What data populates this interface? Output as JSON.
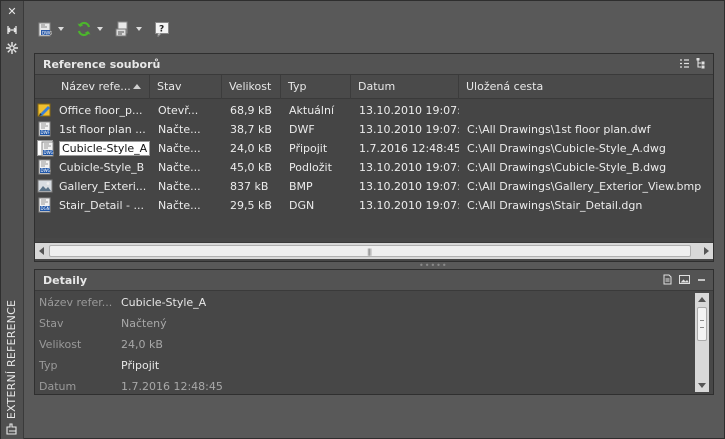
{
  "palette": {
    "panel_title": "EXTERNÍ REFERENCE"
  },
  "toolbar": {
    "buttons": [
      {
        "icon": "attach-dwg-icon",
        "has_dropdown": true
      },
      {
        "icon": "refresh-icon",
        "has_dropdown": true
      },
      {
        "icon": "change-path-icon",
        "has_dropdown": true
      },
      {
        "icon": "help-icon",
        "has_dropdown": false
      }
    ]
  },
  "file_references": {
    "title": "Reference souborů",
    "columns": [
      "Název refe...",
      "Stav",
      "Velikost",
      "Typ",
      "Datum",
      "Uložená cesta"
    ],
    "rows": [
      {
        "icon": "drawing-current-icon",
        "name": "Office floor_p...",
        "status": "Otevř...",
        "size": "68,9 kB",
        "type": "Aktuální",
        "date": "13.10.2010 19:07:...",
        "path": ""
      },
      {
        "icon": "dwf-file-icon",
        "name": "1st floor plan ...",
        "status": "Načte...",
        "size": "38,7 kB",
        "type": "DWF",
        "date": "13.10.2010 19:07:...",
        "path": "C:\\All Drawings\\1st floor plan.dwf"
      },
      {
        "icon": "dwg-file-icon",
        "name": "Cubicle-Style_A",
        "status": "Načte...",
        "size": "24,0 kB",
        "type": "Připojit",
        "date": "1.7.2016 12:48:45",
        "path": "C:\\All Drawings\\Cubicle-Style_A.dwg"
      },
      {
        "icon": "dwg-file-icon",
        "name": "Cubicle-Style_B",
        "status": "Načte...",
        "size": "45,0 kB",
        "type": "Podložit",
        "date": "13.10.2010 19:07:...",
        "path": "C:\\All Drawings\\Cubicle-Style_B.dwg"
      },
      {
        "icon": "image-file-icon",
        "name": "Gallery_Exteri...",
        "status": "Načte...",
        "size": "837 kB",
        "type": "BMP",
        "date": "13.10.2010 19:07:...",
        "path": "C:\\All Drawings\\Gallery_Exterior_View.bmp"
      },
      {
        "icon": "dgn-file-icon",
        "name": "Stair_Detail - ...",
        "status": "Načte...",
        "size": "29,5 kB",
        "type": "DGN",
        "date": "13.10.2010 19:07:...",
        "path": "C:\\All Drawings\\Stair_Detail.dgn"
      }
    ]
  },
  "details": {
    "title": "Detaily",
    "fields": [
      {
        "label": "Název refer...",
        "value": "Cubicle-Style_A",
        "muted": false
      },
      {
        "label": "Stav",
        "value": "Načtený",
        "muted": true
      },
      {
        "label": "Velikost",
        "value": "24,0 kB",
        "muted": true
      },
      {
        "label": "Typ",
        "value": "Připojit",
        "muted": false
      },
      {
        "label": "Datum",
        "value": "1.7.2016 12:48:45",
        "muted": true
      }
    ]
  }
}
